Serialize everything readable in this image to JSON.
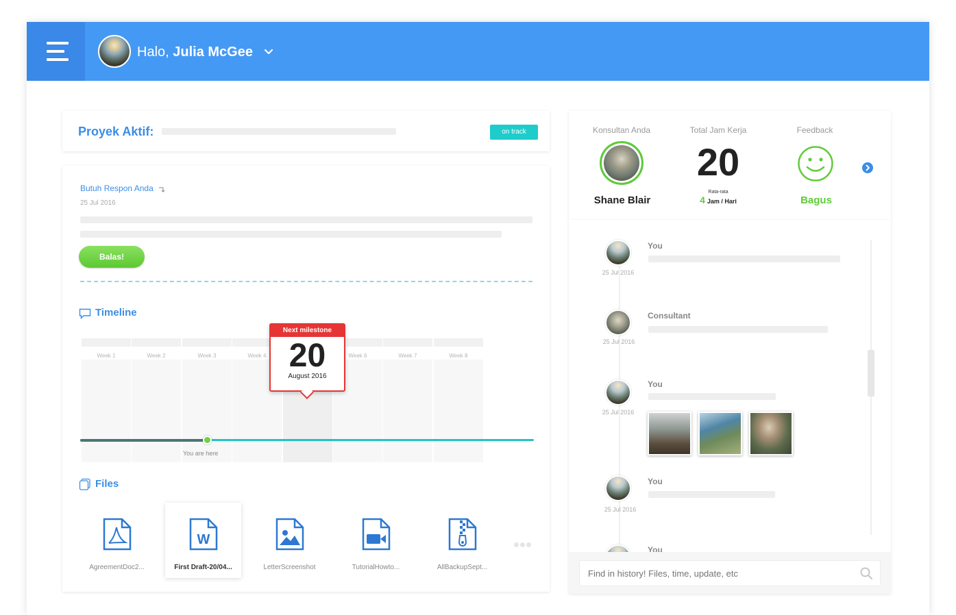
{
  "header": {
    "greeting": "Halo,",
    "user_name": "Julia McGee"
  },
  "project": {
    "title": "Proyek Aktif:",
    "status": "on track"
  },
  "response": {
    "link": "Butuh Respon Anda",
    "date": "25 Jul 2016",
    "reply_label": "Balas!"
  },
  "timeline": {
    "title": "Timeline",
    "weeks": [
      "Week 1",
      "Week 2",
      "Week 3",
      "Week 4",
      "Week 5",
      "Week 6",
      "Week 7",
      "Week 8"
    ],
    "progress_fraction": 0.28,
    "you_are_here": "You are here",
    "milestone": {
      "label": "Next milestone",
      "day": "20",
      "month_year": "August 2016"
    }
  },
  "files": {
    "title": "Files",
    "items": [
      {
        "name": "AgreementDoc2...",
        "icon": "pdf-file-icon"
      },
      {
        "name": "First Draft-20/04...",
        "icon": "word-file-icon"
      },
      {
        "name": "LetterScreenshot",
        "icon": "image-file-icon"
      },
      {
        "name": "TutorialHowto...",
        "icon": "video-file-icon"
      },
      {
        "name": "AllBackupSept...",
        "icon": "zip-file-icon"
      }
    ]
  },
  "stats": {
    "consultant_label": "Konsultan Anda",
    "consultant_name": "Shane Blair",
    "hours_label": "Total Jam Kerja",
    "hours_total": "20",
    "avg_label": "Rata-rata",
    "avg_value": "4",
    "avg_unit": "Jam / Hari",
    "feedback_label": "Feedback",
    "feedback_value": "Bagus"
  },
  "history": {
    "entries": [
      {
        "who": "You",
        "date": "25 Jul 2016"
      },
      {
        "who": "Consultant",
        "date": "25 Jul 2016"
      },
      {
        "who": "You",
        "date": "25 Jul 2016"
      },
      {
        "who": "You",
        "date": "25 Jul 2016"
      },
      {
        "who": "You",
        "date": ""
      }
    ],
    "search_placeholder": "Find in history! Files, time, update, etc"
  },
  "colors": {
    "header_blue": "#4499f5",
    "accent_blue": "#3a8ee6",
    "green": "#5fcb3a",
    "teal": "#21c4c8",
    "red": "#e53535"
  }
}
